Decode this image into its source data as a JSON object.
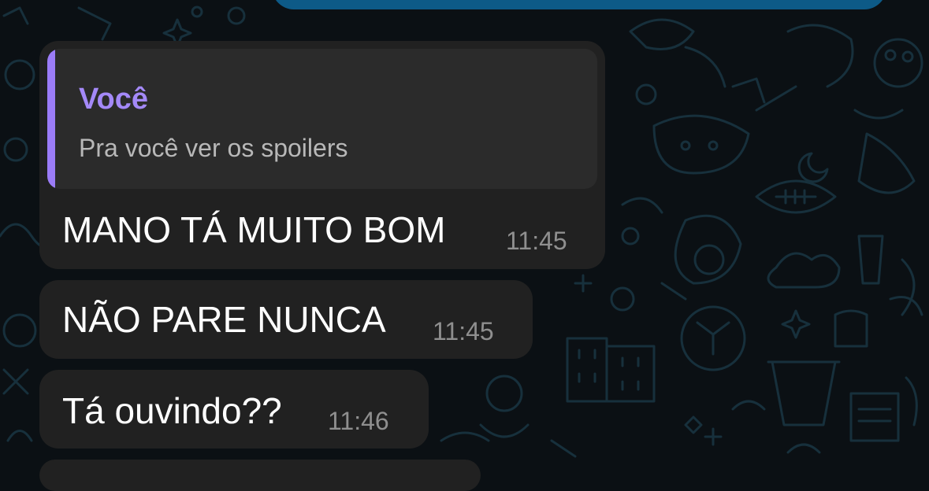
{
  "chat": {
    "messages": [
      {
        "reply_to": {
          "author": "Você",
          "text": "Pra você ver os spoilers"
        },
        "text": "MANO TÁ MUITO BOM",
        "time": "11:45"
      },
      {
        "text": "NÃO PARE NUNCA",
        "time": "11:45"
      },
      {
        "text": "Tá ouvindo??",
        "time": "11:46"
      }
    ]
  },
  "colors": {
    "background": "#0b1014",
    "bubble_incoming": "#212121",
    "bubble_outgoing": "#0d5a87",
    "quote_accent": "#9b7cf7",
    "timestamp": "#8f8f8f"
  }
}
